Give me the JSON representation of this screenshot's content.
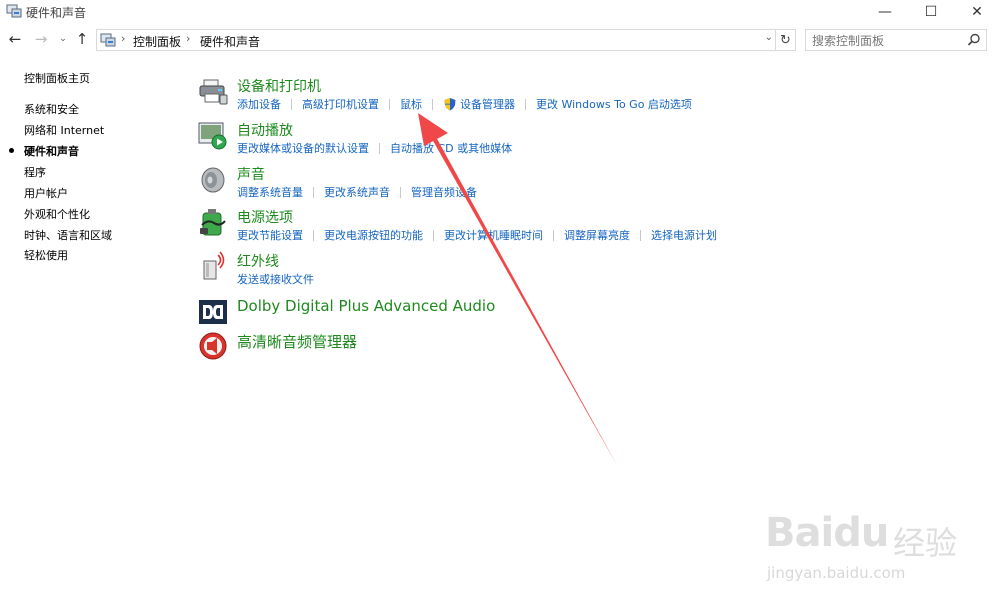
{
  "window": {
    "title": "硬件和声音",
    "minimize": "—",
    "maximize": "☐",
    "close": "✕"
  },
  "nav": {
    "back": "←",
    "forward": "→",
    "recent": "⌄",
    "up": "↑",
    "breadcrumb": [
      "控制面板",
      "硬件和声音"
    ],
    "breadcrumb_sep": "›",
    "dropdown": "⌄",
    "refresh": "↻",
    "search_placeholder": "搜索控制面板"
  },
  "sidebar": {
    "items": [
      {
        "label": "控制面板主页",
        "active": false
      },
      {
        "label": "系统和安全",
        "active": false
      },
      {
        "label": "网络和 Internet",
        "active": false
      },
      {
        "label": "硬件和声音",
        "active": true
      },
      {
        "label": "程序",
        "active": false
      },
      {
        "label": "用户帐户",
        "active": false
      },
      {
        "label": "外观和个性化",
        "active": false
      },
      {
        "label": "时钟、语言和区域",
        "active": false
      },
      {
        "label": "轻松使用",
        "active": false
      }
    ]
  },
  "categories": [
    {
      "title": "设备和打印机",
      "icon": "printer-icon",
      "links": [
        "添加设备",
        "高级打印机设置",
        "鼠标",
        "设备管理器",
        "更改 Windows To Go 启动选项"
      ]
    },
    {
      "title": "自动播放",
      "icon": "autoplay-icon",
      "links": [
        "更改媒体或设备的默认设置",
        "自动播放 CD 或其他媒体"
      ]
    },
    {
      "title": "声音",
      "icon": "speaker-icon",
      "links": [
        "调整系统音量",
        "更改系统声音",
        "管理音频设备"
      ]
    },
    {
      "title": "电源选项",
      "icon": "power-icon",
      "links": [
        "更改节能设置",
        "更改电源按钮的功能",
        "更改计算机睡眠时间",
        "调整屏幕亮度",
        "选择电源计划"
      ]
    },
    {
      "title": "红外线",
      "icon": "infrared-icon",
      "links": [
        "发送或接收文件"
      ]
    },
    {
      "title": "Dolby Digital Plus Advanced Audio",
      "icon": "dolby-icon",
      "links": []
    },
    {
      "title": "高清晰音频管理器",
      "icon": "hd-audio-icon",
      "links": []
    }
  ],
  "watermark": {
    "logo": "Bai",
    "logo2": "du",
    "cn": "经验",
    "url": "jingyan.baidu.com"
  },
  "colors": {
    "category_title": "#1e8a1e",
    "link": "#1565c0",
    "annotation_arrow": "#f04848"
  }
}
